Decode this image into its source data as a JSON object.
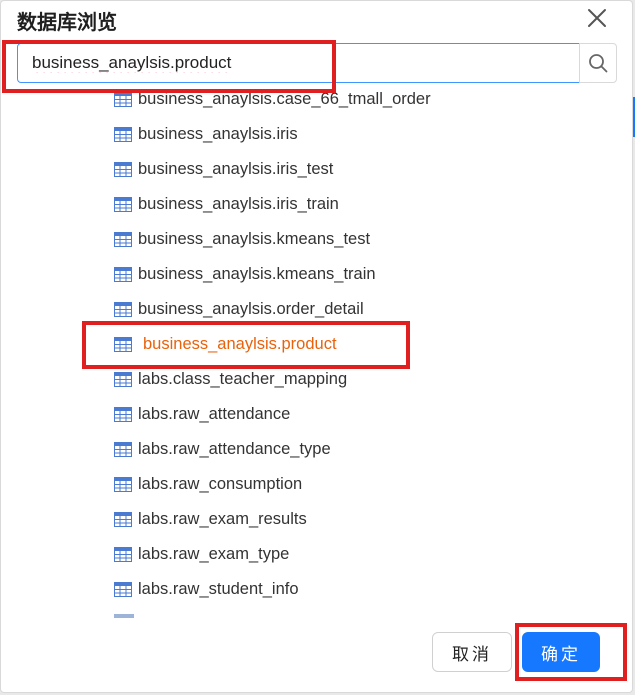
{
  "modal": {
    "title": "数据库浏览"
  },
  "search": {
    "value": "business_anaylsis.product"
  },
  "tree": {
    "items": [
      {
        "label": "business_anaylsis.case_66_tmall_order"
      },
      {
        "label": "business_anaylsis.iris"
      },
      {
        "label": "business_anaylsis.iris_test"
      },
      {
        "label": "business_anaylsis.iris_train"
      },
      {
        "label": "business_anaylsis.kmeans_test"
      },
      {
        "label": "business_anaylsis.kmeans_train"
      },
      {
        "label": "business_anaylsis.order_detail"
      },
      {
        "label": "business_anaylsis.product",
        "selected": true
      },
      {
        "label": "labs.class_teacher_mapping"
      },
      {
        "label": "labs.raw_attendance"
      },
      {
        "label": "labs.raw_attendance_type"
      },
      {
        "label": "labs.raw_consumption"
      },
      {
        "label": "labs.raw_exam_results"
      },
      {
        "label": "labs.raw_exam_type"
      },
      {
        "label": "labs.raw_student_info"
      }
    ]
  },
  "footer": {
    "cancel_label": "取消",
    "ok_label": "确定"
  },
  "colors": {
    "primary": "#1677ff",
    "selected_text": "#e8620c",
    "annotation_red": "#e02020",
    "table_icon": "#4a7bd0"
  },
  "icons": {
    "close": "close-icon",
    "search": "search-icon",
    "table": "table-icon"
  }
}
